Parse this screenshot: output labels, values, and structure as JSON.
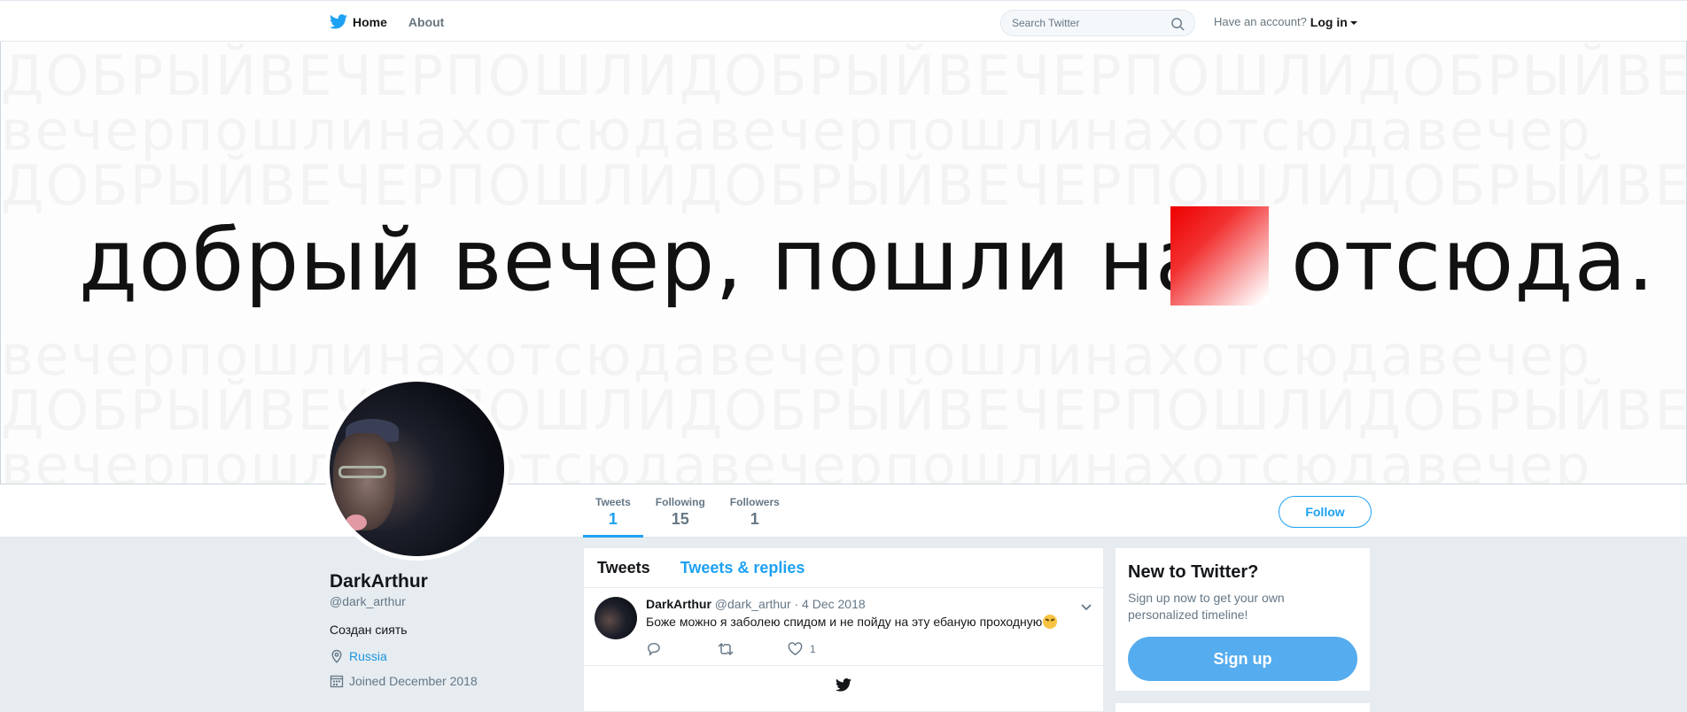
{
  "nav": {
    "home_label": "Home",
    "about_label": "About",
    "search_placeholder": "Search Twitter",
    "have_account": "Have an account?",
    "login_label": "Log in"
  },
  "banner": {
    "text_before": "добрый вечер, пошли нах",
    "text_after": "отсюда."
  },
  "profile": {
    "name": "DarkArthur",
    "handle": "@dark_arthur",
    "bio": "Создан сиять",
    "location": "Russia",
    "joined": "Joined December 2018"
  },
  "stats": [
    {
      "label": "Tweets",
      "value": "1"
    },
    {
      "label": "Following",
      "value": "15"
    },
    {
      "label": "Followers",
      "value": "1"
    }
  ],
  "follow_label": "Follow",
  "timeline": {
    "tab_tweets": "Tweets",
    "tab_replies": "Tweets & replies",
    "tweet": {
      "name": "DarkArthur",
      "handle": "@dark_arthur",
      "date": "· 4 Dec 2018",
      "text": "Боже можно я заболею спидом и не пойду на эту ебаную проходную",
      "likes": "1"
    }
  },
  "sidebar": {
    "title": "New to Twitter?",
    "desc": "Sign up now to get your own personalized timeline!",
    "signup_label": "Sign up"
  },
  "colors": {
    "accent": "#1da1f2",
    "background": "#e6ecf0",
    "signup_button": "#55acee",
    "censor_red": "#ee0000"
  }
}
